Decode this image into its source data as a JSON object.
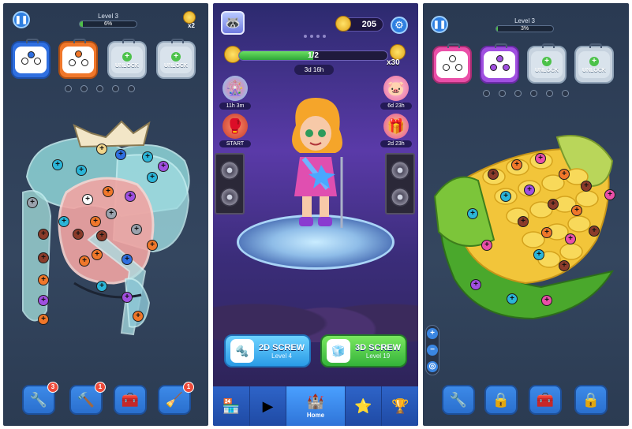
{
  "left_screen": {
    "level_title": "Level 3",
    "progress_percent": 6,
    "progress_text": "6%",
    "key_count": "x2",
    "boxes": [
      {
        "color": "#2f6fe0",
        "locked": false,
        "slots": 2
      },
      {
        "color": "#f0772a",
        "locked": false,
        "slots": 3
      },
      {
        "color": "#c7d3df",
        "locked": true,
        "label": "UNLOCK"
      },
      {
        "color": "#c7d3df",
        "locked": true,
        "label": "UNLOCK"
      }
    ],
    "empty_slots": 5,
    "tools": [
      {
        "icon": "drill-icon",
        "badge": "3"
      },
      {
        "icon": "hammer-icon",
        "badge": "1"
      },
      {
        "icon": "toolbox-icon",
        "badge": ""
      },
      {
        "icon": "broom-icon",
        "badge": "1"
      }
    ]
  },
  "middle_screen": {
    "coins": "205",
    "pass_progress": "1/2",
    "pass_fraction": 0.5,
    "pass_timer": "3d 16h",
    "reward_mult": "x30",
    "side_events": {
      "left": [
        {
          "icon": "wheel-icon",
          "label": "11h 3m"
        },
        {
          "icon": "glove-icon",
          "label": "START"
        }
      ],
      "right": [
        {
          "icon": "piggy-bank-icon",
          "label": "6d 23h"
        },
        {
          "icon": "gift-icon",
          "label": "2d 23h"
        }
      ]
    },
    "mode_2d": {
      "title": "2D SCREW",
      "subtitle": "Level 4"
    },
    "mode_3d": {
      "title": "3D SCREW",
      "subtitle": "Level 19"
    },
    "nav": [
      {
        "icon": "shop-icon",
        "label": ""
      },
      {
        "icon": "video-icon",
        "label": ""
      },
      {
        "icon": "home-icon",
        "label": "Home",
        "active": true
      },
      {
        "icon": "star-icon",
        "label": ""
      },
      {
        "icon": "trophy-icon",
        "label": ""
      }
    ]
  },
  "right_screen": {
    "level_title": "Level 3",
    "progress_percent": 3,
    "progress_text": "3%",
    "boxes": [
      {
        "color": "#ea4fa8",
        "locked": false,
        "slots": 3
      },
      {
        "color": "#a04fe0",
        "locked": false,
        "slots": 3
      },
      {
        "color": "#c7d3df",
        "locked": true,
        "label": "UNLOCK"
      },
      {
        "color": "#c7d3df",
        "locked": true,
        "label": "UNLOCK"
      }
    ],
    "empty_slots": 6,
    "tools": [
      {
        "icon": "drill-icon",
        "badge": ""
      },
      {
        "icon": "lock-icon",
        "badge": ""
      },
      {
        "icon": "toolbox-icon",
        "badge": ""
      },
      {
        "icon": "lock-icon",
        "badge": ""
      }
    ]
  }
}
